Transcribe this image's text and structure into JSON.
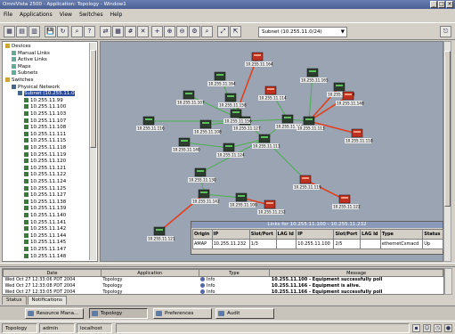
{
  "window": {
    "title": "OmniVista 2500 - Application: Topology - Window1"
  },
  "menu": [
    "File",
    "Applications",
    "View",
    "Switches",
    "Help"
  ],
  "toolbar": {
    "icons": [
      "layout-icon",
      "layout2-icon",
      "layout3-icon",
      "save-icon",
      "refresh-icon",
      "find-icon",
      "help-icon",
      "links-icon",
      "table-icon",
      "grid-icon",
      "delete-icon",
      "add-node-icon",
      "zoom-in-icon",
      "zoom-out-icon",
      "settings-icon",
      "search-icon",
      "fit-icon",
      "expand-icon"
    ],
    "subnet": "Subnet (10.255.11.0/24)"
  },
  "tree": {
    "rows": [
      {
        "label": "Devices",
        "indent": 0
      },
      {
        "label": "Manual Links",
        "indent": 1
      },
      {
        "label": "Active Links",
        "indent": 1
      },
      {
        "label": "Maps",
        "indent": 1
      },
      {
        "label": "Subnets",
        "indent": 1
      },
      {
        "label": "Switches",
        "indent": 0
      },
      {
        "label": "Physical Network",
        "indent": 1
      },
      {
        "label": "Subnet (10.255.11.0",
        "indent": 2
      },
      {
        "label": "10.255.11.99",
        "indent": 3
      },
      {
        "label": "10.255.11.100",
        "indent": 3
      },
      {
        "label": "10.255.11.103",
        "indent": 3
      },
      {
        "label": "10.255.11.107",
        "indent": 3
      },
      {
        "label": "10.255.11.108",
        "indent": 3
      },
      {
        "label": "10.255.11.111",
        "indent": 3
      },
      {
        "label": "10.255.11.115",
        "indent": 3
      },
      {
        "label": "10.255.11.118",
        "indent": 3
      },
      {
        "label": "10.255.11.119",
        "indent": 3
      },
      {
        "label": "10.255.11.120",
        "indent": 3
      },
      {
        "label": "10.255.11.121",
        "indent": 3
      },
      {
        "label": "10.255.11.122",
        "indent": 3
      },
      {
        "label": "10.255.11.124",
        "indent": 3
      },
      {
        "label": "10.255.11.125",
        "indent": 3
      },
      {
        "label": "10.255.11.127",
        "indent": 3
      },
      {
        "label": "10.255.11.138",
        "indent": 3
      },
      {
        "label": "10.255.11.139",
        "indent": 3
      },
      {
        "label": "10.255.11.140",
        "indent": 3
      },
      {
        "label": "10.255.11.141",
        "indent": 3
      },
      {
        "label": "10.255.11.142",
        "indent": 3
      },
      {
        "label": "10.255.11.144",
        "indent": 3
      },
      {
        "label": "10.255.11.145",
        "indent": 3
      },
      {
        "label": "10.255.11.147",
        "indent": 3
      },
      {
        "label": "10.255.11.148",
        "indent": 3
      }
    ]
  },
  "map": {
    "nodes": [
      {
        "label": "10.255.11.164",
        "state": "down"
      },
      {
        "label": "10.255.11.164",
        "state": "up"
      },
      {
        "label": "10.255.11.107",
        "state": "up"
      },
      {
        "label": "10.255.11.158",
        "state": "up"
      },
      {
        "label": "10.255.11.114",
        "state": "down"
      },
      {
        "label": "10.255.11.165",
        "state": "up"
      },
      {
        "label": "10.255.11.144",
        "state": "up"
      },
      {
        "label": "10.255.11.127",
        "state": "up"
      },
      {
        "label": "10.255.11.156",
        "state": "up"
      },
      {
        "label": "10.255.11.148",
        "state": "down"
      },
      {
        "label": "10.255.11.116",
        "state": "up"
      },
      {
        "label": "10.255.11.108",
        "state": "up"
      },
      {
        "label": "10.255.11.115",
        "state": "up"
      },
      {
        "label": "10.255.11.118",
        "state": "down"
      },
      {
        "label": "10.255.11.113",
        "state": "up"
      },
      {
        "label": "10.255.11.124",
        "state": "up"
      },
      {
        "label": "10.255.11.140",
        "state": "up"
      },
      {
        "label": "10.255.11.111",
        "state": "up"
      },
      {
        "label": "10.255.11.130",
        "state": "up"
      },
      {
        "label": "10.255.11.142",
        "state": "up"
      },
      {
        "label": "10.255.11.100",
        "state": "up"
      },
      {
        "label": "10.255.11.232",
        "state": "down"
      },
      {
        "label": "10.255.11.122",
        "state": "down"
      },
      {
        "label": "10.255.11.121",
        "state": "up"
      },
      {
        "label": "10.255.11.119",
        "state": "down"
      }
    ],
    "colors": {
      "normal_link": "#4caf50",
      "down_link": "#e04020"
    }
  },
  "links_panel": {
    "title": "Links for 10.255.11.100 - 10.255.11.232",
    "headers": [
      "Origin",
      "IP",
      "Slot/Port",
      "LAG Id",
      "IP",
      "Slot/Port",
      "LAG Id",
      "Type",
      "Status"
    ],
    "rows": [
      [
        "AMAP",
        "10.255.11.232",
        "1/3",
        "",
        "10.255.11.100",
        "2/5",
        "",
        "ethernetCsmacd",
        "Up"
      ]
    ]
  },
  "events": {
    "headers": [
      "Date",
      "Application",
      "Type",
      "Message"
    ],
    "rows": [
      {
        "date": "Wed Oct 27 12:33:06 PDT 2004",
        "app": "Topology",
        "type": "Info",
        "msg": "10.255.11.100 - Equipment successfully poll"
      },
      {
        "date": "Wed Oct 27 12:33:08 PDT 2004",
        "app": "Topology",
        "type": "Info",
        "msg": "10.255.11.166 - Equipment is alive."
      },
      {
        "date": "Wed Oct 27 12:33:05 PDT 2004",
        "app": "Topology",
        "type": "Info",
        "msg": "10.255.11.166 - Equipment successfully poll"
      }
    ]
  },
  "tabs": [
    "Status",
    "Notifications"
  ],
  "taskbar": [
    "Resource Mana...",
    "Topology",
    "Preferences",
    "Audit"
  ],
  "statusbar": {
    "app": "Topology",
    "user": "admin",
    "host": "localhost"
  }
}
